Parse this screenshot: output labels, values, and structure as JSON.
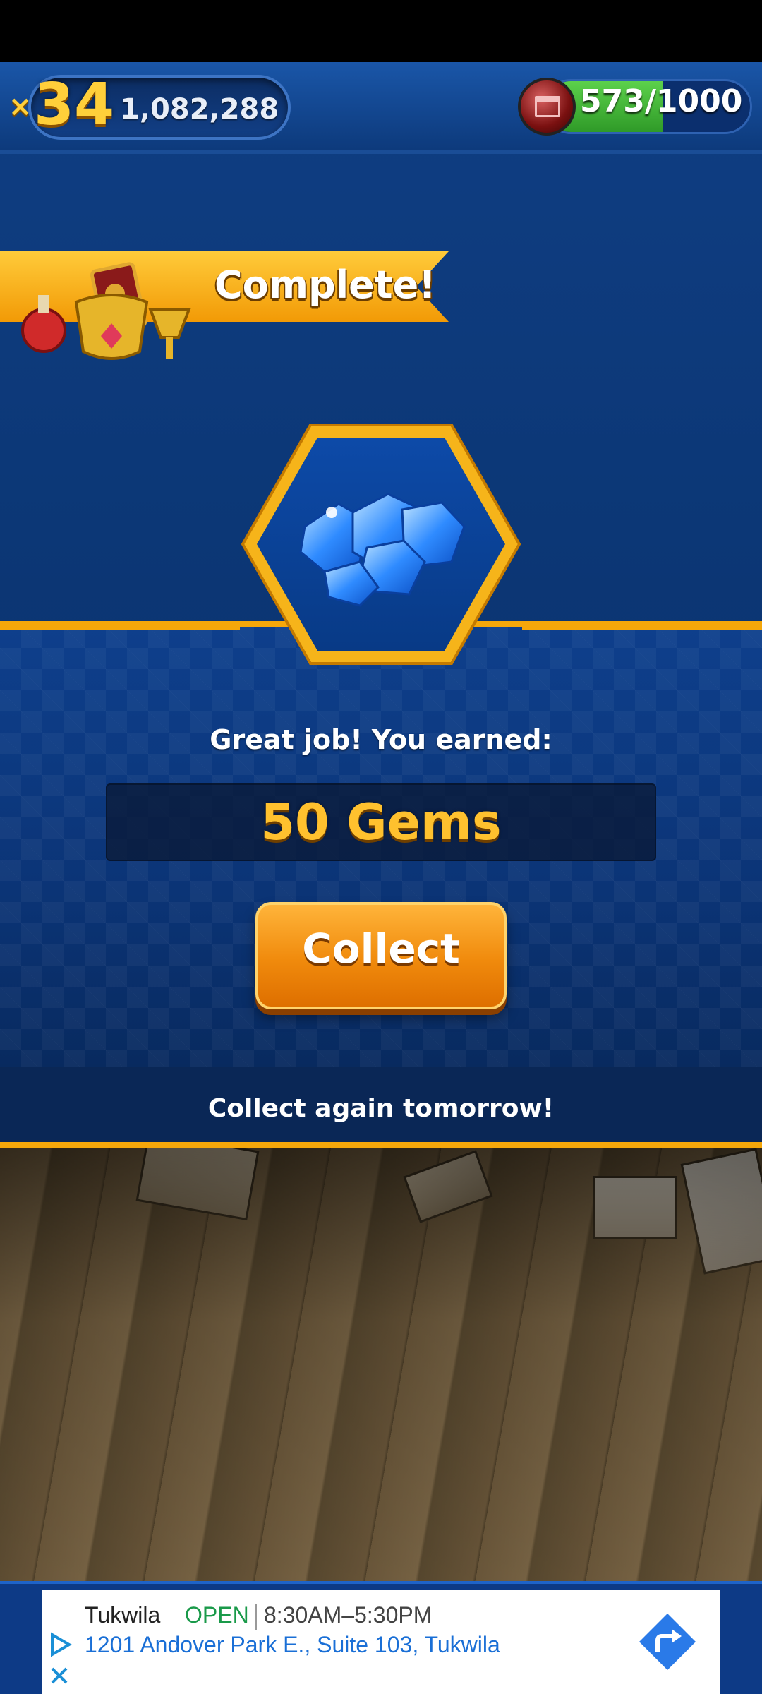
{
  "hud": {
    "multiplier_prefix": "×",
    "multiplier": "34",
    "score": "1,082,288",
    "energy": "573/1000",
    "energy_fraction": 0.573
  },
  "banner": {
    "title": "Complete!"
  },
  "reward": {
    "earned_label": "Great job! You earned:",
    "amount": "50 Gems",
    "collect_label": "Collect",
    "tomorrow_label": "Collect again tomorrow!"
  },
  "ad": {
    "name": "Tukwila",
    "status": "OPEN",
    "hours": "8:30AM–5:30PM",
    "address": "1201 Andover Park E., Suite 103, Tukwila"
  },
  "colors": {
    "accent_gold": "#f5a70a",
    "panel_blue": "#0b3476",
    "button_orange": "#f08a0c",
    "gem_blue": "#2f8bff",
    "open_green": "#1a9a4a",
    "link_blue": "#1a6fd6"
  }
}
